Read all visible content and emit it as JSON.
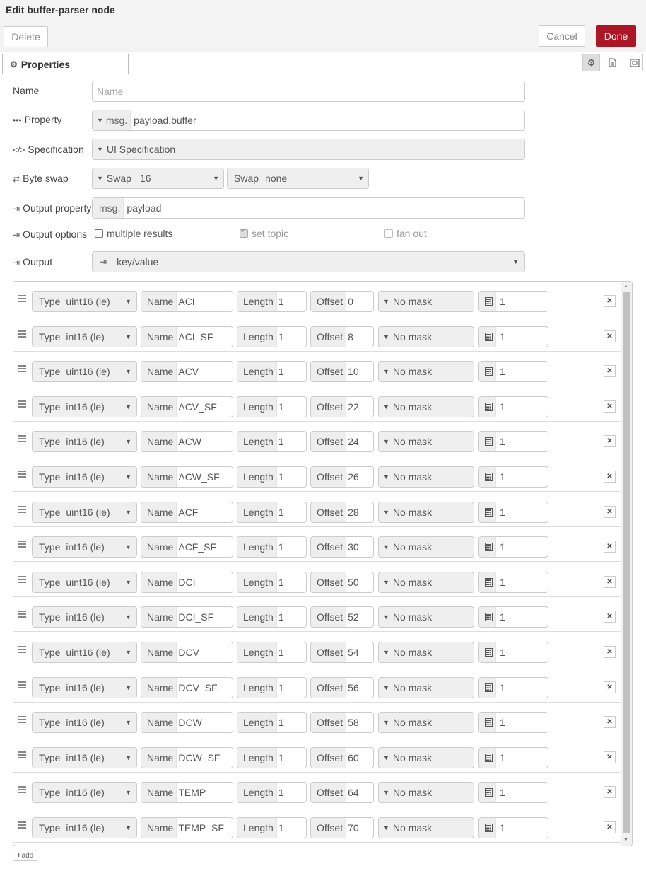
{
  "window": {
    "title": "Edit buffer-parser node"
  },
  "toolbar": {
    "delete": "Delete",
    "cancel": "Cancel",
    "done": "Done"
  },
  "tabs": {
    "properties": "Properties"
  },
  "form": {
    "name_label": "Name",
    "name_placeholder": "Name",
    "property_label": "Property",
    "property_prefix": "msg.",
    "property_value": "payload.buffer",
    "spec_label": "Specification",
    "spec_value": "UI Specification",
    "byteswap_label": "Byte swap",
    "swap1_label": "Swap",
    "swap1_value": "16",
    "swap2_label": "Swap",
    "swap2_value": "none",
    "output_property_label": "Output property",
    "output_prefix": "msg.",
    "output_value": "payload",
    "output_options_label": "Output options",
    "opt_multiple": "multiple results",
    "opt_topic": "set topic",
    "opt_fanout": "fan out",
    "output_label": "Output",
    "output_mode": "key/value"
  },
  "rows_labels": {
    "type": "Type",
    "name": "Name",
    "length": "Length",
    "offset": "Offset",
    "mask": "No mask"
  },
  "rows": [
    {
      "type": "uint16 (le)",
      "name": "ACI",
      "length": "1",
      "offset": "0",
      "scale": "1"
    },
    {
      "type": "int16 (le)",
      "name": "ACI_SF",
      "length": "1",
      "offset": "8",
      "scale": "1"
    },
    {
      "type": "uint16 (le)",
      "name": "ACV",
      "length": "1",
      "offset": "10",
      "scale": "1"
    },
    {
      "type": "int16 (le)",
      "name": "ACV_SF",
      "length": "1",
      "offset": "22",
      "scale": "1"
    },
    {
      "type": "int16 (le)",
      "name": "ACW",
      "length": "1",
      "offset": "24",
      "scale": "1"
    },
    {
      "type": "int16 (le)",
      "name": "ACW_SF",
      "length": "1",
      "offset": "26",
      "scale": "1"
    },
    {
      "type": "uint16 (le)",
      "name": "ACF",
      "length": "1",
      "offset": "28",
      "scale": "1"
    },
    {
      "type": "int16 (le)",
      "name": "ACF_SF",
      "length": "1",
      "offset": "30",
      "scale": "1"
    },
    {
      "type": "uint16 (le)",
      "name": "DCI",
      "length": "1",
      "offset": "50",
      "scale": "1"
    },
    {
      "type": "int16 (le)",
      "name": "DCI_SF",
      "length": "1",
      "offset": "52",
      "scale": "1"
    },
    {
      "type": "uint16 (le)",
      "name": "DCV",
      "length": "1",
      "offset": "54",
      "scale": "1"
    },
    {
      "type": "int16 (le)",
      "name": "DCV_SF",
      "length": "1",
      "offset": "56",
      "scale": "1"
    },
    {
      "type": "int16 (le)",
      "name": "DCW",
      "length": "1",
      "offset": "58",
      "scale": "1"
    },
    {
      "type": "int16 (le)",
      "name": "DCW_SF",
      "length": "1",
      "offset": "60",
      "scale": "1"
    },
    {
      "type": "int16 (le)",
      "name": "TEMP",
      "length": "1",
      "offset": "64",
      "scale": "1"
    },
    {
      "type": "int16 (le)",
      "name": "TEMP_SF",
      "length": "1",
      "offset": "70",
      "scale": "1"
    }
  ],
  "add_label": "add",
  "icons": [
    "gear-icon",
    "description-icon",
    "appearance-icon",
    "ellipsis-icon",
    "code-icon",
    "swap-icon",
    "sign-out-icon",
    "grip-icon",
    "calculator-icon",
    "close-icon",
    "plus-icon",
    "caret-down-icon"
  ]
}
